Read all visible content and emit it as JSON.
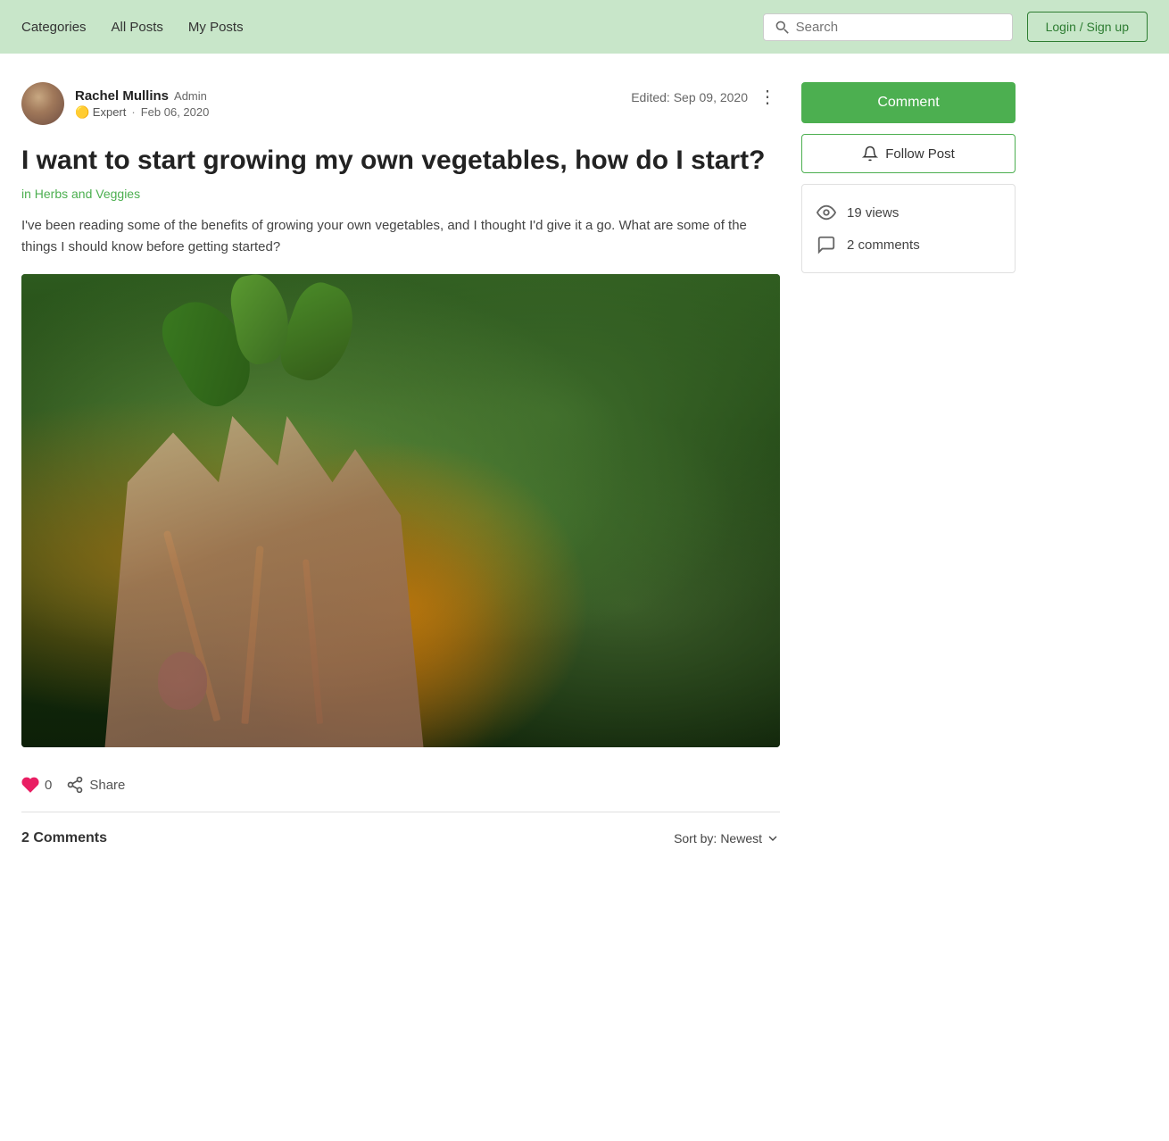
{
  "nav": {
    "categories_label": "Categories",
    "all_posts_label": "All Posts",
    "my_posts_label": "My Posts",
    "search_placeholder": "Search",
    "login_label": "Login / Sign up"
  },
  "post": {
    "author_name": "Rachel Mullins",
    "author_badge": "Admin",
    "author_role": "🟡 Expert",
    "post_date": "Feb 06, 2020",
    "edited_label": "Edited:",
    "edited_date": "Sep 09, 2020",
    "title": "I want to start growing my own vegetables, how do I start?",
    "category": "in Herbs and Veggies",
    "body": "I've been reading some of the benefits of growing your own vegetables, and I thought I'd give it a go. What are some of the things I should know before getting started?",
    "like_count": "0",
    "share_label": "Share",
    "comments_count_label": "2 Comments",
    "sort_by_label": "Sort by:",
    "sort_option": "Newest"
  },
  "sidebar": {
    "comment_btn_label": "Comment",
    "follow_btn_label": "Follow Post",
    "views_count": "19 views",
    "comments_count": "2 comments"
  }
}
